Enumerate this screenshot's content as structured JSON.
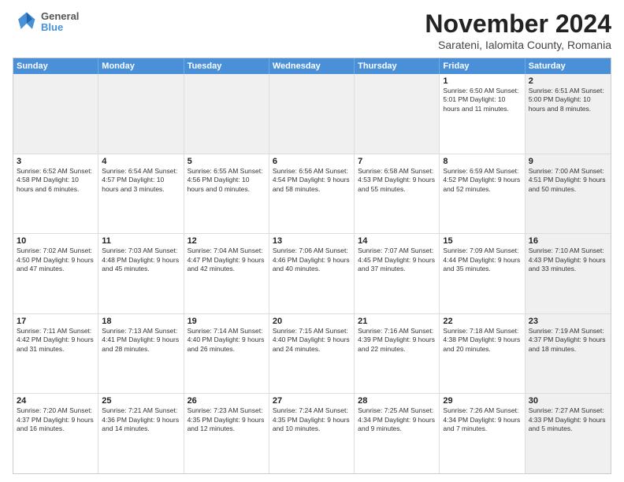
{
  "logo": {
    "line1": "General",
    "line2": "Blue"
  },
  "title": "November 2024",
  "subtitle": "Sarateni, Ialomita County, Romania",
  "header_days": [
    "Sunday",
    "Monday",
    "Tuesday",
    "Wednesday",
    "Thursday",
    "Friday",
    "Saturday"
  ],
  "weeks": [
    [
      {
        "day": "",
        "info": "",
        "shaded": true
      },
      {
        "day": "",
        "info": "",
        "shaded": true
      },
      {
        "day": "",
        "info": "",
        "shaded": true
      },
      {
        "day": "",
        "info": "",
        "shaded": true
      },
      {
        "day": "",
        "info": "",
        "shaded": true
      },
      {
        "day": "1",
        "info": "Sunrise: 6:50 AM\nSunset: 5:01 PM\nDaylight: 10 hours and 11 minutes.",
        "shaded": false
      },
      {
        "day": "2",
        "info": "Sunrise: 6:51 AM\nSunset: 5:00 PM\nDaylight: 10 hours and 8 minutes.",
        "shaded": true
      }
    ],
    [
      {
        "day": "3",
        "info": "Sunrise: 6:52 AM\nSunset: 4:58 PM\nDaylight: 10 hours and 6 minutes.",
        "shaded": false
      },
      {
        "day": "4",
        "info": "Sunrise: 6:54 AM\nSunset: 4:57 PM\nDaylight: 10 hours and 3 minutes.",
        "shaded": false
      },
      {
        "day": "5",
        "info": "Sunrise: 6:55 AM\nSunset: 4:56 PM\nDaylight: 10 hours and 0 minutes.",
        "shaded": false
      },
      {
        "day": "6",
        "info": "Sunrise: 6:56 AM\nSunset: 4:54 PM\nDaylight: 9 hours and 58 minutes.",
        "shaded": false
      },
      {
        "day": "7",
        "info": "Sunrise: 6:58 AM\nSunset: 4:53 PM\nDaylight: 9 hours and 55 minutes.",
        "shaded": false
      },
      {
        "day": "8",
        "info": "Sunrise: 6:59 AM\nSunset: 4:52 PM\nDaylight: 9 hours and 52 minutes.",
        "shaded": false
      },
      {
        "day": "9",
        "info": "Sunrise: 7:00 AM\nSunset: 4:51 PM\nDaylight: 9 hours and 50 minutes.",
        "shaded": true
      }
    ],
    [
      {
        "day": "10",
        "info": "Sunrise: 7:02 AM\nSunset: 4:50 PM\nDaylight: 9 hours and 47 minutes.",
        "shaded": false
      },
      {
        "day": "11",
        "info": "Sunrise: 7:03 AM\nSunset: 4:48 PM\nDaylight: 9 hours and 45 minutes.",
        "shaded": false
      },
      {
        "day": "12",
        "info": "Sunrise: 7:04 AM\nSunset: 4:47 PM\nDaylight: 9 hours and 42 minutes.",
        "shaded": false
      },
      {
        "day": "13",
        "info": "Sunrise: 7:06 AM\nSunset: 4:46 PM\nDaylight: 9 hours and 40 minutes.",
        "shaded": false
      },
      {
        "day": "14",
        "info": "Sunrise: 7:07 AM\nSunset: 4:45 PM\nDaylight: 9 hours and 37 minutes.",
        "shaded": false
      },
      {
        "day": "15",
        "info": "Sunrise: 7:09 AM\nSunset: 4:44 PM\nDaylight: 9 hours and 35 minutes.",
        "shaded": false
      },
      {
        "day": "16",
        "info": "Sunrise: 7:10 AM\nSunset: 4:43 PM\nDaylight: 9 hours and 33 minutes.",
        "shaded": true
      }
    ],
    [
      {
        "day": "17",
        "info": "Sunrise: 7:11 AM\nSunset: 4:42 PM\nDaylight: 9 hours and 31 minutes.",
        "shaded": false
      },
      {
        "day": "18",
        "info": "Sunrise: 7:13 AM\nSunset: 4:41 PM\nDaylight: 9 hours and 28 minutes.",
        "shaded": false
      },
      {
        "day": "19",
        "info": "Sunrise: 7:14 AM\nSunset: 4:40 PM\nDaylight: 9 hours and 26 minutes.",
        "shaded": false
      },
      {
        "day": "20",
        "info": "Sunrise: 7:15 AM\nSunset: 4:40 PM\nDaylight: 9 hours and 24 minutes.",
        "shaded": false
      },
      {
        "day": "21",
        "info": "Sunrise: 7:16 AM\nSunset: 4:39 PM\nDaylight: 9 hours and 22 minutes.",
        "shaded": false
      },
      {
        "day": "22",
        "info": "Sunrise: 7:18 AM\nSunset: 4:38 PM\nDaylight: 9 hours and 20 minutes.",
        "shaded": false
      },
      {
        "day": "23",
        "info": "Sunrise: 7:19 AM\nSunset: 4:37 PM\nDaylight: 9 hours and 18 minutes.",
        "shaded": true
      }
    ],
    [
      {
        "day": "24",
        "info": "Sunrise: 7:20 AM\nSunset: 4:37 PM\nDaylight: 9 hours and 16 minutes.",
        "shaded": false
      },
      {
        "day": "25",
        "info": "Sunrise: 7:21 AM\nSunset: 4:36 PM\nDaylight: 9 hours and 14 minutes.",
        "shaded": false
      },
      {
        "day": "26",
        "info": "Sunrise: 7:23 AM\nSunset: 4:35 PM\nDaylight: 9 hours and 12 minutes.",
        "shaded": false
      },
      {
        "day": "27",
        "info": "Sunrise: 7:24 AM\nSunset: 4:35 PM\nDaylight: 9 hours and 10 minutes.",
        "shaded": false
      },
      {
        "day": "28",
        "info": "Sunrise: 7:25 AM\nSunset: 4:34 PM\nDaylight: 9 hours and 9 minutes.",
        "shaded": false
      },
      {
        "day": "29",
        "info": "Sunrise: 7:26 AM\nSunset: 4:34 PM\nDaylight: 9 hours and 7 minutes.",
        "shaded": false
      },
      {
        "day": "30",
        "info": "Sunrise: 7:27 AM\nSunset: 4:33 PM\nDaylight: 9 hours and 5 minutes.",
        "shaded": true
      }
    ]
  ]
}
